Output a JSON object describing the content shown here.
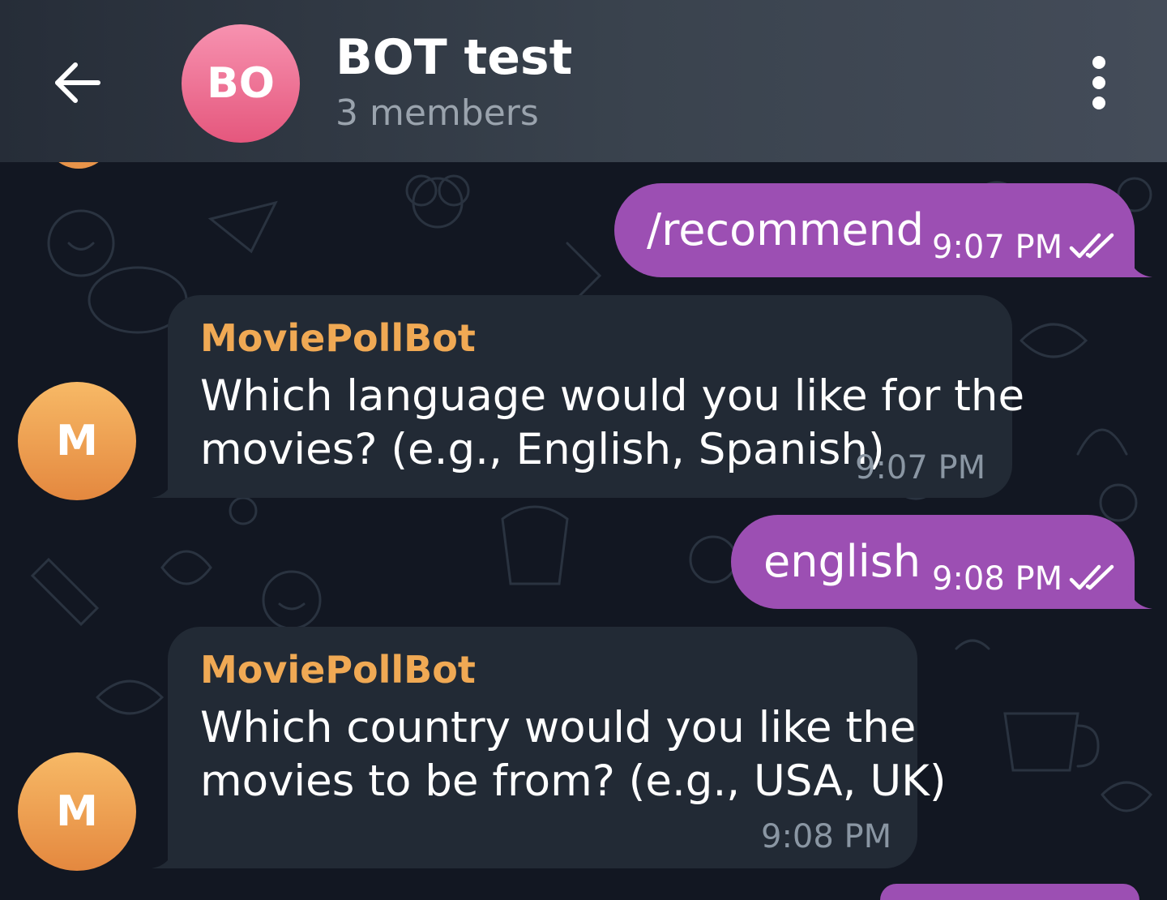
{
  "header": {
    "back_icon": "arrow-left-icon",
    "avatar_initials": "BO",
    "title": "BOT test",
    "subtitle": "3 members",
    "menu_icon": "more-vertical-icon"
  },
  "messages": [
    {
      "direction": "outgoing",
      "text": "/recommend",
      "time": "9:07 PM",
      "status_icon": "double-check-icon"
    },
    {
      "direction": "incoming",
      "sender": "MoviePollBot",
      "avatar_initial": "M",
      "lines": [
        "Which language would you like for the",
        "movies? (e.g., English, Spanish)"
      ],
      "time": "9:07 PM"
    },
    {
      "direction": "outgoing",
      "text": "english",
      "time": "9:08 PM",
      "status_icon": "double-check-icon"
    },
    {
      "direction": "incoming",
      "sender": "MoviePollBot",
      "avatar_initial": "M",
      "lines": [
        "Which country would you like the",
        "movies to be from? (e.g., USA, UK)"
      ],
      "time": "9:08 PM"
    }
  ],
  "colors": {
    "outgoing_bubble": "#9c4fb3",
    "incoming_bubble": "#222a35",
    "sender_name": "#f0a954",
    "background": "#121722"
  }
}
